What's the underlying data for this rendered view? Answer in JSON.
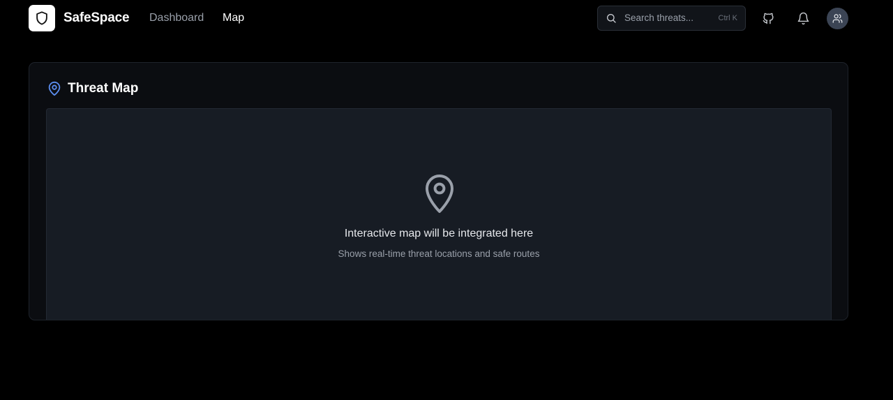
{
  "app": {
    "brand": "SafeSpace",
    "logo_icon": "shield-icon"
  },
  "nav": {
    "items": [
      {
        "label": "Dashboard",
        "active": false
      },
      {
        "label": "Map",
        "active": true
      }
    ]
  },
  "search": {
    "placeholder": "Search threats...",
    "shortcut": "Ctrl K",
    "icon": "search-icon"
  },
  "header_actions": {
    "github_icon": "github-icon",
    "bell_icon": "bell-icon",
    "avatar_icon": "users-icon"
  },
  "card": {
    "title": "Threat Map",
    "title_icon": "map-pin-icon",
    "map": {
      "heading": "Interactive map will be integrated here",
      "subheading": "Shows real-time threat locations and safe routes",
      "icon": "map-pin-icon"
    }
  },
  "colors": {
    "background": "#000000",
    "accent": "#5b8def",
    "card_bg": "#0b0d11",
    "map_bg": "#171c24"
  }
}
